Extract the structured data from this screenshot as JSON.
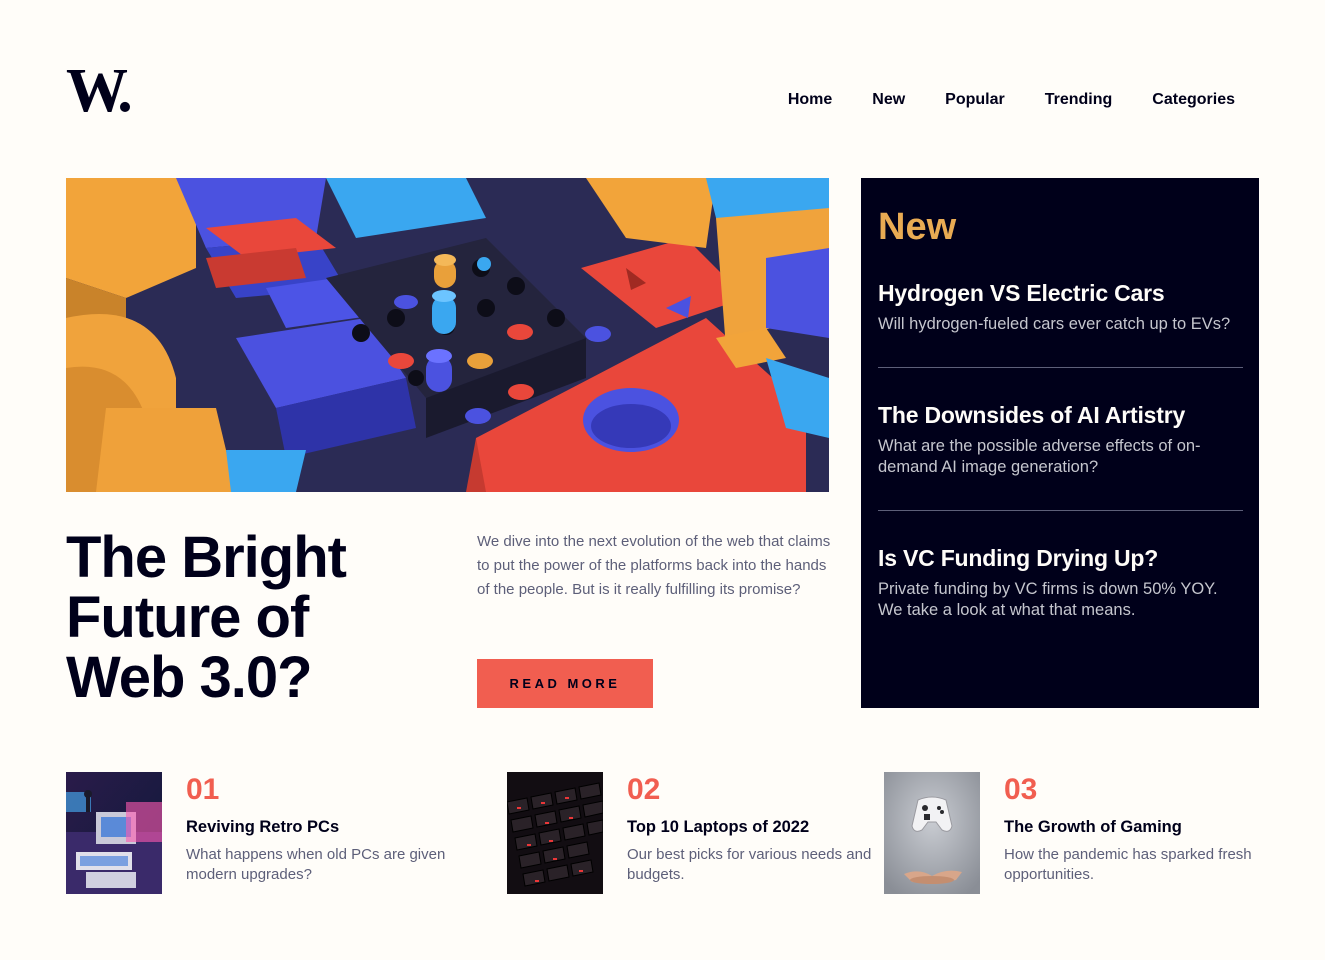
{
  "brand": {
    "logo_text": "W."
  },
  "nav": {
    "items": [
      "Home",
      "New",
      "Popular",
      "Trending",
      "Categories"
    ]
  },
  "hero": {
    "headline_lines": [
      "The Bright",
      "Future of",
      "Web 3.0?"
    ],
    "description": "We dive into the next evolution of the web that claims to put the power of the platforms back into the hands of the people. But is it really fulfilling its promise?",
    "button_label": "READ MORE",
    "image_icon": "abstract-3d-blocks-image"
  },
  "new_panel": {
    "title": "New",
    "items": [
      {
        "title": "Hydrogen VS Electric Cars",
        "desc": "Will hydrogen-fueled cars ever catch up to EVs?"
      },
      {
        "title": "The Downsides of AI Artistry",
        "desc": "What are the possible adverse effects of on-demand AI image generation?"
      },
      {
        "title": "Is VC Funding Drying Up?",
        "desc": "Private funding by VC firms is down 50% YOY. We take a look at what that means."
      }
    ]
  },
  "cards": [
    {
      "num": "01",
      "title": "Reviving Retro PCs",
      "desc": "What happens when old PCs are given modern upgrades?",
      "image_icon": "retro-pc-image"
    },
    {
      "num": "02",
      "title": "Top 10 Laptops of 2022",
      "desc": "Our best picks for various needs and budgets.",
      "image_icon": "laptop-keyboard-image"
    },
    {
      "num": "03",
      "title": "The Growth of Gaming",
      "desc": "How the pandemic has sparked fresh opportunities.",
      "image_icon": "game-controller-image"
    }
  ],
  "colors": {
    "background": "#fffdf9",
    "dark_navy": "#00001a",
    "soft_red": "#f15e50",
    "soft_orange": "#e9ab53",
    "grayish_blue": "#5d5f79",
    "grayish_light": "#c5c6ce"
  }
}
